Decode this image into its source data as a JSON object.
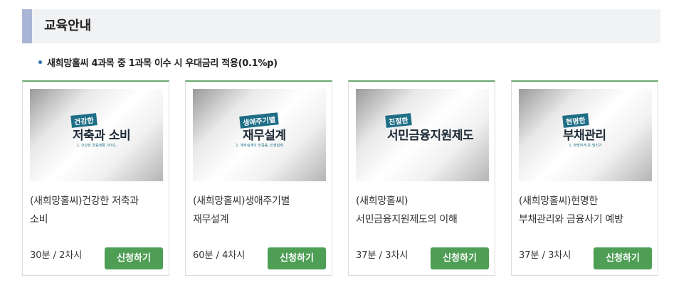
{
  "section": {
    "title": "교육안내"
  },
  "notice": {
    "text": "새희망홀씨 4과목 중 1과목 이수 시 우대금리 적용(0.1%p)"
  },
  "courses": [
    {
      "thumb_tag": "건강한",
      "thumb_title": "저축과 소비",
      "thumb_sub": "1. 건강한 금융생활 가이드",
      "title_line1": "(새희망홀씨)건강한 저축과",
      "title_line2": "소비",
      "meta": "30분 / 2차시",
      "button": "신청하기"
    },
    {
      "thumb_tag": "생애주기별",
      "thumb_title": "재무설계",
      "thumb_sub": "1. 재무설계의 첫걸음, 인생설계",
      "title_line1": "(새희망홀씨)생애주기별",
      "title_line2": "재무설계",
      "meta": "60분 / 4차시",
      "button": "신청하기"
    },
    {
      "thumb_tag": "친절한",
      "thumb_title": "서민금융지원제도",
      "thumb_sub": "",
      "title_line1": "(새희망홀씨)",
      "title_line2": "서민금융지원제도의 이해",
      "meta": "37분 / 3차시",
      "button": "신청하기"
    },
    {
      "thumb_tag": "현명한",
      "thumb_title": "부채관리",
      "thumb_sub": "1. 현명하게 돈 빌리기",
      "title_line1": "(새희망홀씨)현명한",
      "title_line2": "부채관리와 금융사기 예방",
      "meta": "37분 / 3차시",
      "button": "신청하기"
    }
  ],
  "colors": {
    "accent_bar": "#aab4d6",
    "header_bg": "#f1f2f4",
    "card_top_border": "#6aa86c",
    "button_bg": "#4e9e55",
    "bullet": "#2a6fb0"
  }
}
